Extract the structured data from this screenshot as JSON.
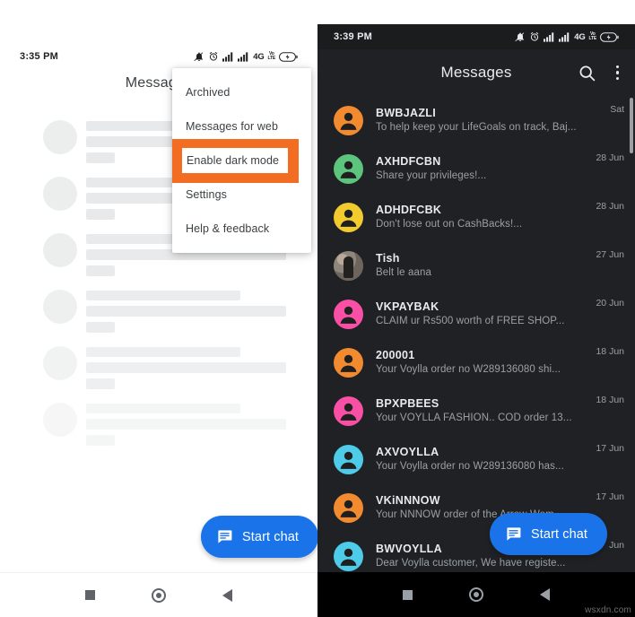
{
  "light_phone": {
    "statusbar": {
      "time": "3:35 PM",
      "network_label": "4G",
      "volte_top": "Vo",
      "volte_bottom": "LTE",
      "icons": [
        "bell-muted-icon",
        "alarm-icon",
        "signal-bars-icon",
        "signal-bars-icon",
        "volte-icon",
        "battery-icon"
      ]
    },
    "app_title": "Messages",
    "menu": {
      "items": [
        {
          "label": "Archived"
        },
        {
          "label": "Messages for web"
        },
        {
          "label": "Enable dark mode",
          "highlighted": true
        },
        {
          "label": "Settings"
        },
        {
          "label": "Help & feedback"
        }
      ],
      "highlight_color": "#f26d21"
    },
    "fab": {
      "label": "Start chat",
      "icon": "chat-bubble-icon",
      "color": "#1a73e8"
    },
    "skeleton_row_count": 6,
    "navbar": {
      "recents": "recents-square-icon",
      "home": "home-circle-icon",
      "back": "back-triangle-icon"
    }
  },
  "dark_phone": {
    "statusbar": {
      "time": "3:39 PM",
      "network_label": "4G",
      "volte_top": "Vo",
      "volte_bottom": "LTE"
    },
    "app_title": "Messages",
    "actions": {
      "search": "search-icon",
      "overflow": "kebab-menu-icon"
    },
    "conversations": [
      {
        "name": "BWBJAZLI",
        "snippet": "To help keep your LifeGoals on track, Baj...",
        "date": "Sat",
        "avatar_color": "#f28b30",
        "avatar_type": "person"
      },
      {
        "name": "AXHDFCBN",
        "snippet": "Share your privileges!...",
        "date": "28 Jun",
        "avatar_color": "#5cc47c",
        "avatar_type": "person"
      },
      {
        "name": "ADHDFCBK",
        "snippet": "Don't lose out on CashBacks!...",
        "date": "28 Jun",
        "avatar_color": "#f2cb2f",
        "avatar_type": "person"
      },
      {
        "name": "Tish",
        "snippet": "Belt le aana",
        "date": "27 Jun",
        "avatar_color": "#8e867c",
        "avatar_type": "photo"
      },
      {
        "name": "VKPAYBAK",
        "snippet": "CLAIM ur Rs500 worth of FREE SHOP...",
        "date": "20 Jun",
        "avatar_color": "#f94fa4",
        "avatar_type": "person"
      },
      {
        "name": "200001",
        "snippet": "Your Voylla order no W289136080 shi...",
        "date": "18 Jun",
        "avatar_color": "#f28b30",
        "avatar_type": "person"
      },
      {
        "name": "BPXPBEES",
        "snippet": "Your VOYLLA FASHION.. COD order 13...",
        "date": "18 Jun",
        "avatar_color": "#f94fa4",
        "avatar_type": "person"
      },
      {
        "name": "AXVOYLLA",
        "snippet": "Your Voylla order no W289136080 has...",
        "date": "17 Jun",
        "avatar_color": "#4ecbe8",
        "avatar_type": "person"
      },
      {
        "name": "VKiNNNOW",
        "snippet": "Your NNNOW order of the Arrow Wom...",
        "date": "17 Jun",
        "avatar_color": "#f28b30",
        "avatar_type": "person"
      },
      {
        "name": "BWVOYLLA",
        "snippet": "Dear Voylla customer, We have registe...",
        "date": "Jun",
        "avatar_color": "#4ecbe8",
        "avatar_type": "person"
      }
    ],
    "fab": {
      "label": "Start chat",
      "icon": "chat-bubble-icon",
      "color": "#1a73e8"
    },
    "navbar": {
      "recents": "recents-square-icon",
      "home": "home-circle-icon",
      "back": "back-triangle-icon"
    }
  },
  "watermark": "wsxdn.com"
}
